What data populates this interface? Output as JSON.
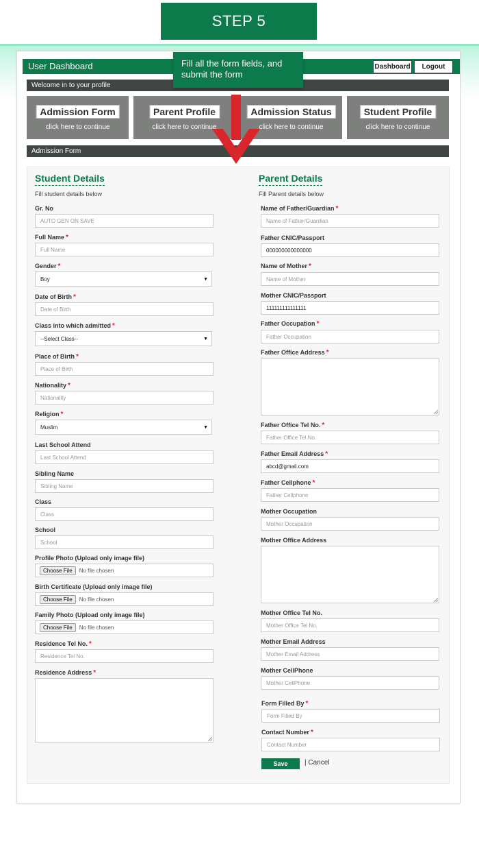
{
  "step_banner": "STEP 5",
  "tooltip": "Fill all the form fields, and submit the form",
  "header": {
    "title": "User Dashboard",
    "dashboard_label": "Dashboard",
    "logout_label": "Logout"
  },
  "welcome_bar": "Welcome in to your profile",
  "tiles": [
    {
      "title": "Admission Form",
      "subtitle": "click here to continue"
    },
    {
      "title": "Parent Profile",
      "subtitle": "click here to continue"
    },
    {
      "title": "Admission Status",
      "subtitle": "click here to continue"
    },
    {
      "title": "Student Profile",
      "subtitle": "click here to continue"
    }
  ],
  "section_bar": "Admission Form",
  "student": {
    "title": "Student Details",
    "subtitle": "Fill student details below",
    "fields": {
      "gr_no": {
        "label": "Gr. No",
        "placeholder": "AUTO GEN ON SAVE"
      },
      "full_name": {
        "label": "Full Name",
        "placeholder": "Full Name"
      },
      "gender": {
        "label": "Gender",
        "value": "Boy"
      },
      "dob": {
        "label": "Date of Birth",
        "placeholder": "Date of Birth"
      },
      "class_admitted": {
        "label": "Class into which admitted",
        "value": "--Select Class--"
      },
      "place_of_birth": {
        "label": "Place of Birth",
        "placeholder": "Place of Birth"
      },
      "nationality": {
        "label": "Nationality",
        "placeholder": "Nationality"
      },
      "religion": {
        "label": "Religion",
        "value": "Muslim"
      },
      "last_school": {
        "label": "Last School Attend",
        "placeholder": "Last School Attend"
      },
      "sibling_name": {
        "label": "Sibling Name",
        "placeholder": "Sibling Name"
      },
      "class": {
        "label": "Class",
        "placeholder": "Class"
      },
      "school": {
        "label": "School",
        "placeholder": "School"
      },
      "profile_photo": {
        "label": "Profile Photo (Upload only image file)",
        "button": "Choose File",
        "status": "No file chosen"
      },
      "birth_cert": {
        "label": "Birth Certificate (Upload only image file)",
        "button": "Choose File",
        "status": "No file chosen"
      },
      "family_photo": {
        "label": "Family Photo (Upload only image file)",
        "button": "Choose File",
        "status": "No file chosen"
      },
      "residence_tel": {
        "label": "Residence Tel No.",
        "placeholder": "Residence Tel No."
      },
      "residence_address": {
        "label": "Residence Address"
      }
    }
  },
  "parent": {
    "title": "Parent Details",
    "subtitle": "Fill Parent details below",
    "fields": {
      "father_name": {
        "label": "Name of Father/Guardian",
        "placeholder": "Name of Father/Guardian"
      },
      "father_cnic": {
        "label": "Father CNIC/Passport",
        "value": "000000000000000"
      },
      "mother_name": {
        "label": "Name of Mother",
        "placeholder": "Name of Mother"
      },
      "mother_cnic": {
        "label": "Mother CNIC/Passport",
        "value": "111111111111111"
      },
      "father_occupation": {
        "label": "Father Occupation",
        "placeholder": "Father Occupation"
      },
      "father_office_address": {
        "label": "Father Office Address"
      },
      "father_office_tel": {
        "label": "Father Office Tel No.",
        "placeholder": "Father Office Tel No."
      },
      "father_email": {
        "label": "Father Email Address",
        "value": "abcd@gmail.com"
      },
      "father_cell": {
        "label": "Father Cellphone",
        "placeholder": "Father Cellphone"
      },
      "mother_occupation": {
        "label": "Mother Occupation",
        "placeholder": "Mother Occupation"
      },
      "mother_office_address": {
        "label": "Mother Office Address"
      },
      "mother_office_tel": {
        "label": "Mother Office Tel No.",
        "placeholder": "Mother Office Tel No."
      },
      "mother_email": {
        "label": "Mother Email Address",
        "placeholder": "Mother Email Address"
      },
      "mother_cell": {
        "label": "Mother CellPhone",
        "placeholder": "Mother CellPhone"
      },
      "form_filled_by": {
        "label": "Form Filled By",
        "placeholder": "Form Filled By"
      },
      "contact_number": {
        "label": "Contact Number",
        "placeholder": "Contact Number"
      }
    }
  },
  "actions": {
    "save": "Save",
    "cancel": "| Cancel"
  },
  "colors": {
    "brand_green": "#0c7a4a",
    "dark_bar": "#3f4643",
    "tile_gray": "#7e807e",
    "required_red": "#d9262c",
    "arrow_red": "#d9262c"
  }
}
